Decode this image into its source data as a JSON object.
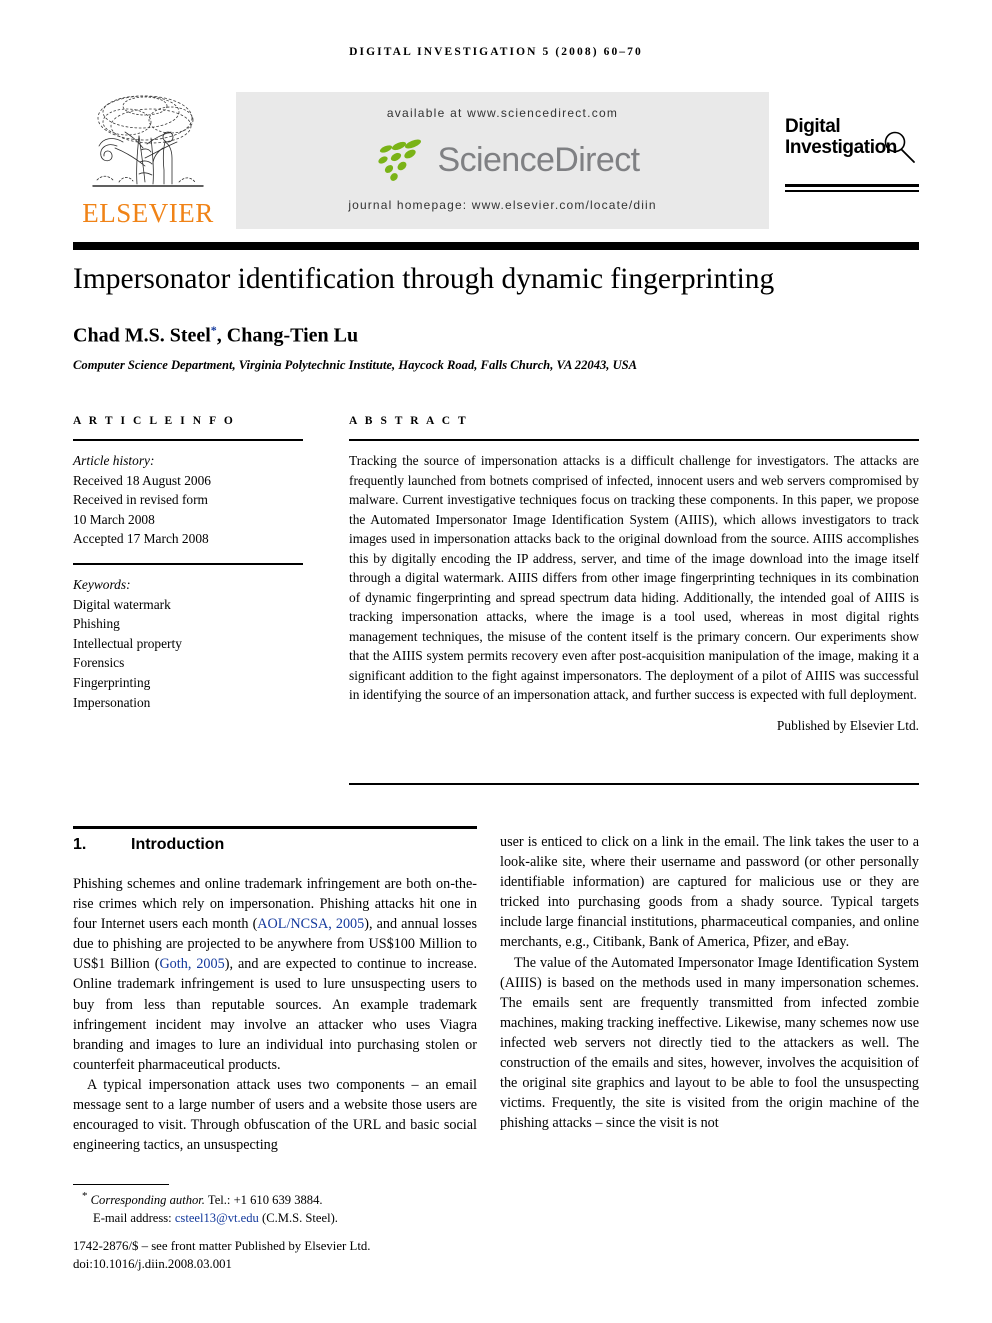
{
  "running_head": "DIGITAL INVESTIGATION 5 (2008) 60–70",
  "masthead": {
    "publisher_name": "ELSEVIER",
    "available_at": "available at www.sciencedirect.com",
    "sciencedirect_word": "ScienceDirect",
    "journal_homepage": "journal homepage: www.elsevier.com/locate/diin",
    "journal_logo_line1": "Digital",
    "journal_logo_line2": "Investigation",
    "colors": {
      "elsevier_orange": "#F08317",
      "sciencedirect_green": "#7AB317",
      "sciencedirect_gray": "#7F8083",
      "panel_background": "#E9E9E9",
      "link_blue": "#12389C"
    }
  },
  "article": {
    "title": "Impersonator identification through dynamic fingerprinting",
    "authors": "Chad M.S. Steel",
    "author_marker": "*",
    "authors_rest": ", Chang-Tien Lu",
    "affiliation": "Computer Science Department, Virginia Polytechnic Institute, Haycock Road, Falls Church, VA 22043, USA"
  },
  "article_info": {
    "heading": "A R T I C L E   I N F O",
    "history_label": "Article history:",
    "history": [
      "Received 18 August 2006",
      "Received in revised form",
      "10 March 2008",
      "Accepted 17 March 2008"
    ],
    "keywords_label": "Keywords:",
    "keywords": [
      "Digital watermark",
      "Phishing",
      "Intellectual property",
      "Forensics",
      "Fingerprinting",
      "Impersonation"
    ]
  },
  "abstract": {
    "heading": "A B S T R A C T",
    "text": "Tracking the source of impersonation attacks is a difficult challenge for investigators. The attacks are frequently launched from botnets comprised of infected, innocent users and web servers compromised by malware. Current investigative techniques focus on tracking these components. In this paper, we propose the Automated Impersonator Image Identification System (AIIIS), which allows investigators to track images used in impersonation attacks back to the original download from the source. AIIIS accomplishes this by digitally encoding the IP address, server, and time of the image download into the image itself through a digital watermark. AIIIS differs from other image fingerprinting techniques in its combination of dynamic fingerprinting and spread spectrum data hiding. Additionally, the intended goal of AIIIS is tracking impersonation attacks, where the image is a tool used, whereas in most digital rights management techniques, the misuse of the content itself is the primary concern. Our experiments show that the AIIIS system permits recovery even after post-acquisition manipulation of the image, making it a significant addition to the fight against impersonators. The deployment of a pilot of AIIIS was successful in identifying the source of an impersonation attack, and further success is expected with full deployment.",
    "publisher_line": "Published by Elsevier Ltd."
  },
  "section": {
    "number": "1.",
    "title": "Introduction"
  },
  "body": {
    "left": [
      {
        "parts": [
          {
            "t": "Phishing schemes and online trademark infringement are both on-the-rise crimes which rely on impersonation. Phishing attacks hit one in four Internet users each month ("
          },
          {
            "t": "AOL/NCSA, 2005",
            "link": true
          },
          {
            "t": "), and annual losses due to phishing are projected to be anywhere from US$100 Million to US$1 Billion ("
          },
          {
            "t": "Goth, 2005",
            "link": true
          },
          {
            "t": "), and are expected to continue to increase. Online trademark infringement is used to lure unsuspecting users to buy from less than reputable sources. An example trademark infringement incident may involve an attacker who uses Viagra branding and images to lure an individual into purchasing stolen or counterfeit pharmaceutical products."
          }
        ]
      },
      {
        "parts": [
          {
            "t": "A typical impersonation attack uses two components – an email message sent to a large number of users and a website those users are encouraged to visit. Through obfuscation of the URL and basic social engineering tactics, an unsuspecting"
          }
        ]
      }
    ],
    "right": [
      {
        "parts": [
          {
            "t": "user is enticed to click on a link in the email. The link takes the user to a look-alike site, where their username and password (or other personally identifiable information) are captured for malicious use or they are tricked into purchasing goods from a shady source. Typical targets include large financial institutions, pharmaceutical companies, and online merchants, e.g., Citibank, Bank of America, Pfizer, and eBay."
          }
        ]
      },
      {
        "parts": [
          {
            "t": "The value of the Automated Impersonator Image Identification System (AIIIS) is based on the methods used in many impersonation schemes. The emails sent are frequently transmitted from infected zombie machines, making tracking ineffective. Likewise, many schemes now use infected web servers not directly tied to the attackers as well. The construction of the emails and sites, however, involves the acquisition of the original site graphics and layout to be able to fool the unsuspecting victims. Frequently, the site is visited from the origin machine of the phishing attacks – since the visit is not"
          }
        ]
      }
    ]
  },
  "footnote": {
    "star": "*",
    "corresponding_label": "Corresponding author.",
    "tel": "Tel.: +1 610 639 3884.",
    "email_label": "E-mail address:",
    "email": "csteel13@vt.edu",
    "email_owner": "(C.M.S. Steel).",
    "front_matter": "1742-2876/$ – see front matter Published by Elsevier Ltd.",
    "doi": "doi:10.1016/j.diin.2008.03.001"
  }
}
